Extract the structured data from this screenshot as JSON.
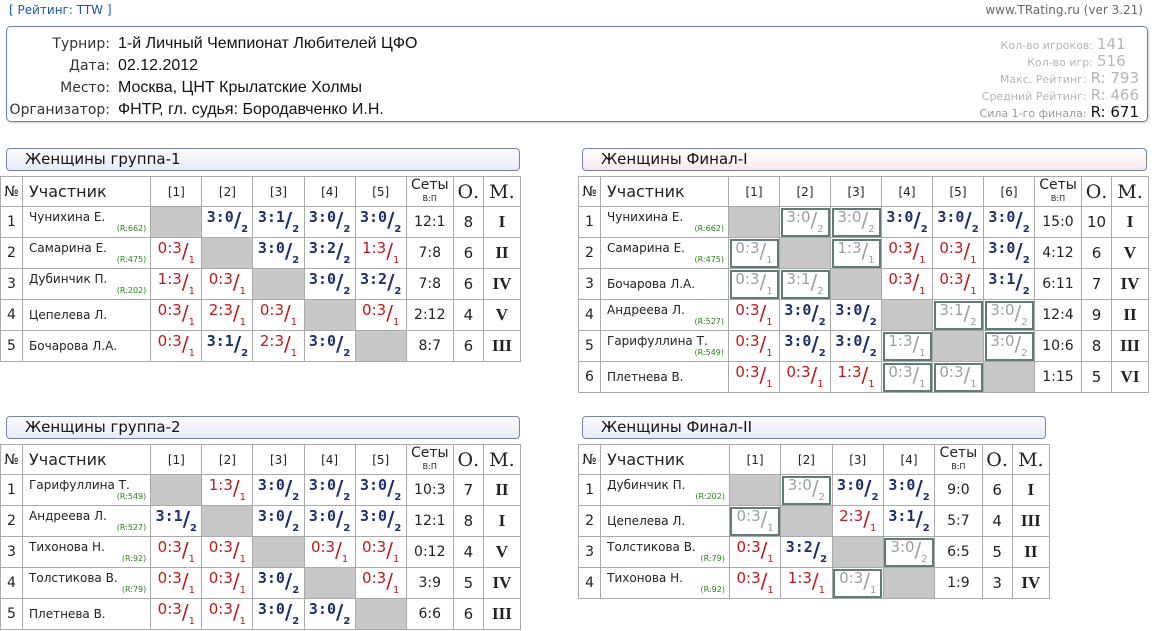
{
  "header": {
    "rating_link": "[ Рейтинг: TTW ]",
    "version": "www.TRating.ru (ver 3.21)"
  },
  "info": [
    {
      "label": "Турнир:",
      "value": "1-й Личный Чемпионат Любителей ЦФО"
    },
    {
      "label": "Дата:",
      "value": "02.12.2012"
    },
    {
      "label": "Место:",
      "value": "Москва, ЦНТ Крылатские Холмы"
    },
    {
      "label": "Организатор:",
      "value": "ФНТР, гл. судья: Бородавченко И.Н."
    }
  ],
  "stats": [
    {
      "label": "Кол-во игроков:",
      "value": "141",
      "strong": false
    },
    {
      "label": "Кол-во игр:",
      "value": "516",
      "strong": false
    },
    {
      "label": "Макс. Рейтинг:",
      "value": "R: 793",
      "strong": false
    },
    {
      "label": "Средний Рейтинг:",
      "value": "R: 466",
      "strong": false
    },
    {
      "label": "Сила 1-го финала:",
      "value": "R: 671",
      "strong": true
    }
  ],
  "headers": {
    "num": "№",
    "participant": "Участник",
    "sets": "Сеты",
    "sets_sub": "В:П",
    "points": "О.",
    "place": "М."
  },
  "groups": [
    {
      "title": "Женщины группа-1",
      "cols": [
        "[1]",
        "[2]",
        "[3]",
        "[4]",
        "[5]"
      ],
      "rows": [
        {
          "n": "1",
          "name": "Чунихина Е.",
          "rating": "(R:662)",
          "cells": [
            "x",
            "W3:0/2",
            "W3:1/2",
            "W3:0/2",
            "W3:0/2"
          ],
          "sets": "12:1",
          "pts": "8",
          "place": "I"
        },
        {
          "n": "2",
          "name": "Самарина Е.",
          "rating": "(R:475)",
          "cells": [
            "L0:3/1",
            "x",
            "W3:0/2",
            "W3:2/2",
            "L1:3/1"
          ],
          "sets": "7:8",
          "pts": "6",
          "place": "II"
        },
        {
          "n": "3",
          "name": "Дубинчик П.",
          "rating": "(R:202)",
          "cells": [
            "L1:3/1",
            "L0:3/1",
            "x",
            "W3:0/2",
            "W3:2/2"
          ],
          "sets": "7:8",
          "pts": "6",
          "place": "IV"
        },
        {
          "n": "4",
          "name": "Цепелева Л.",
          "rating": "",
          "cells": [
            "L0:3/1",
            "L2:3/1",
            "L0:3/1",
            "x",
            "L0:3/1"
          ],
          "sets": "2:12",
          "pts": "4",
          "place": "V"
        },
        {
          "n": "5",
          "name": "Бочарова Л.А.",
          "rating": "",
          "cells": [
            "L0:3/1",
            "W3:1/2",
            "L2:3/1",
            "W3:0/2",
            "x"
          ],
          "sets": "8:7",
          "pts": "6",
          "place": "III"
        }
      ]
    },
    {
      "title": "Женщины группа-2",
      "cols": [
        "[1]",
        "[2]",
        "[3]",
        "[4]",
        "[5]"
      ],
      "rows": [
        {
          "n": "1",
          "name": "Гарифуллина Т.",
          "rating": "(R:549)",
          "cells": [
            "x",
            "L1:3/1",
            "W3:0/2",
            "W3:0/2",
            "W3:0/2"
          ],
          "sets": "10:3",
          "pts": "7",
          "place": "II"
        },
        {
          "n": "2",
          "name": "Андреева Л.",
          "rating": "(R:527)",
          "cells": [
            "W3:1/2",
            "x",
            "W3:0/2",
            "W3:0/2",
            "W3:0/2"
          ],
          "sets": "12:1",
          "pts": "8",
          "place": "I"
        },
        {
          "n": "3",
          "name": "Тихонова Н.",
          "rating": "(R:92)",
          "cells": [
            "L0:3/1",
            "L0:3/1",
            "x",
            "L0:3/1",
            "L0:3/1"
          ],
          "sets": "0:12",
          "pts": "4",
          "place": "V"
        },
        {
          "n": "4",
          "name": "Толстикова В.",
          "rating": "(R:79)",
          "cells": [
            "L0:3/1",
            "L0:3/1",
            "W3:0/2",
            "x",
            "L0:3/1"
          ],
          "sets": "3:9",
          "pts": "5",
          "place": "IV"
        },
        {
          "n": "5",
          "name": "Плетнева В.",
          "rating": "",
          "cells": [
            "L0:3/1",
            "L0:3/1",
            "W3:0/2",
            "W3:0/2",
            "x"
          ],
          "sets": "6:6",
          "pts": "6",
          "place": "III"
        }
      ]
    },
    {
      "title": "Женщины Финал-I",
      "cols": [
        "[1]",
        "[2]",
        "[3]",
        "[4]",
        "[5]",
        "[6]"
      ],
      "rows": [
        {
          "n": "1",
          "name": "Чунихина Е.",
          "rating": "(R:662)",
          "cells": [
            "x",
            "G3:0/2",
            "G3:0/2",
            "W3:0/2",
            "W3:0/2",
            "W3:0/2"
          ],
          "sets": "15:0",
          "pts": "10",
          "place": "I"
        },
        {
          "n": "2",
          "name": "Самарина Е.",
          "rating": "(R:475)",
          "cells": [
            "G0:3/1",
            "x",
            "G1:3/1",
            "L0:3/1",
            "L0:3/1",
            "W3:0/2"
          ],
          "sets": "4:12",
          "pts": "6",
          "place": "V"
        },
        {
          "n": "3",
          "name": "Бочарова Л.А.",
          "rating": "",
          "cells": [
            "G0:3/1",
            "G3:1/2",
            "x",
            "L0:3/1",
            "L0:3/1",
            "W3:1/2"
          ],
          "sets": "6:11",
          "pts": "7",
          "place": "IV"
        },
        {
          "n": "4",
          "name": "Андреева Л.",
          "rating": "(R:527)",
          "cells": [
            "L0:3/1",
            "W3:0/2",
            "W3:0/2",
            "x",
            "G3:1/2",
            "G3:0/2"
          ],
          "sets": "12:4",
          "pts": "9",
          "place": "II"
        },
        {
          "n": "5",
          "name": "Гарифуллина Т.",
          "rating": "(R:549)",
          "cells": [
            "L0:3/1",
            "W3:0/2",
            "W3:0/2",
            "G1:3/1",
            "x",
            "G3:0/2"
          ],
          "sets": "10:6",
          "pts": "8",
          "place": "III"
        },
        {
          "n": "6",
          "name": "Плетнева В.",
          "rating": "",
          "cells": [
            "L0:3/1",
            "L0:3/1",
            "L1:3/1",
            "G0:3/1",
            "G0:3/1",
            "x"
          ],
          "sets": "1:15",
          "pts": "5",
          "place": "VI"
        }
      ]
    },
    {
      "title": "Женщины Финал-II",
      "cols": [
        "[1]",
        "[2]",
        "[3]",
        "[4]"
      ],
      "rows": [
        {
          "n": "1",
          "name": "Дубинчик П.",
          "rating": "(R:202)",
          "cells": [
            "x",
            "G3:0/2",
            "W3:0/2",
            "W3:0/2"
          ],
          "sets": "9:0",
          "pts": "6",
          "place": "I"
        },
        {
          "n": "2",
          "name": "Цепелева Л.",
          "rating": "",
          "cells": [
            "G0:3/1",
            "x",
            "L2:3/1",
            "W3:1/2"
          ],
          "sets": "5:7",
          "pts": "4",
          "place": "III"
        },
        {
          "n": "3",
          "name": "Толстикова В.",
          "rating": "(R:79)",
          "cells": [
            "L0:3/1",
            "W3:2/2",
            "x",
            "G3:0/2"
          ],
          "sets": "6:5",
          "pts": "5",
          "place": "II"
        },
        {
          "n": "4",
          "name": "Тихонова Н.",
          "rating": "(R:92)",
          "cells": [
            "L0:3/1",
            "L1:3/1",
            "G0:3/1",
            "x"
          ],
          "sets": "1:9",
          "pts": "3",
          "place": "IV"
        }
      ]
    }
  ],
  "colors": {
    "win": "#1e2f6a",
    "loss": "#c01818",
    "gray": "#9aa0a0",
    "rating": "#2e7d1f",
    "border": "#7784a8"
  }
}
